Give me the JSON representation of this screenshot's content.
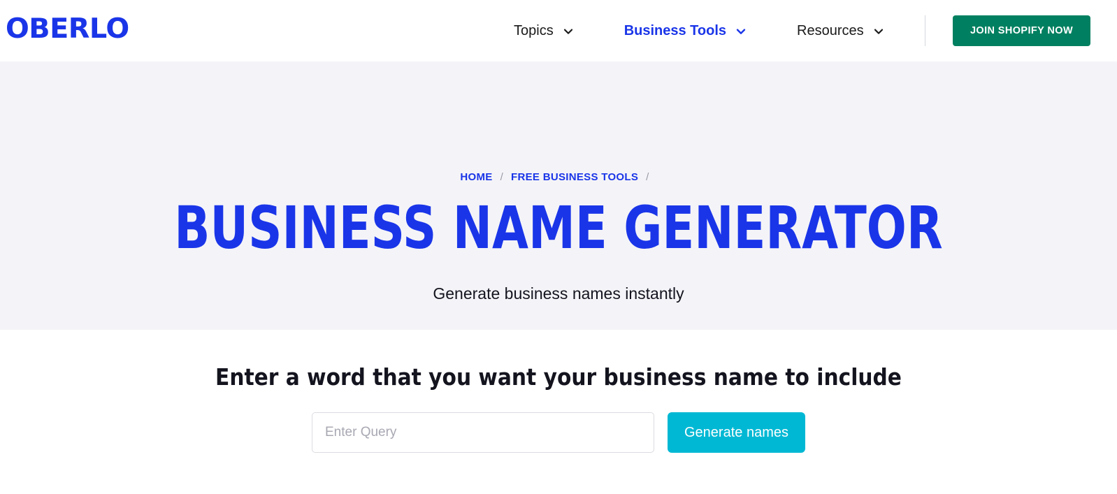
{
  "colors": {
    "brand_blue": "#1a35e8",
    "shopify_green": "#008060",
    "cyan_accent": "#00b8d4",
    "hero_background": "#f4f4f8",
    "text_dark": "#14141f",
    "placeholder_gray": "#a8a8b3"
  },
  "header": {
    "logo_text": "OBERLO",
    "nav": [
      {
        "label": "Topics",
        "icon": "chevron-down-icon",
        "active": false
      },
      {
        "label": "Business Tools",
        "icon": "chevron-down-icon",
        "active": true
      },
      {
        "label": "Resources",
        "icon": "chevron-down-icon",
        "active": false
      }
    ],
    "cta_label": "JOIN SHOPIFY NOW"
  },
  "hero": {
    "breadcrumb": [
      {
        "label": "HOME"
      },
      {
        "label": "FREE BUSINESS TOOLS"
      }
    ],
    "breadcrumb_separator": "/",
    "title": "BUSINESS NAME GENERATOR",
    "subtitle": "Generate business names instantly"
  },
  "form": {
    "heading": "Enter a word that you want your business name to include",
    "input_placeholder": "Enter Query",
    "input_value": "",
    "submit_label": "Generate names"
  }
}
